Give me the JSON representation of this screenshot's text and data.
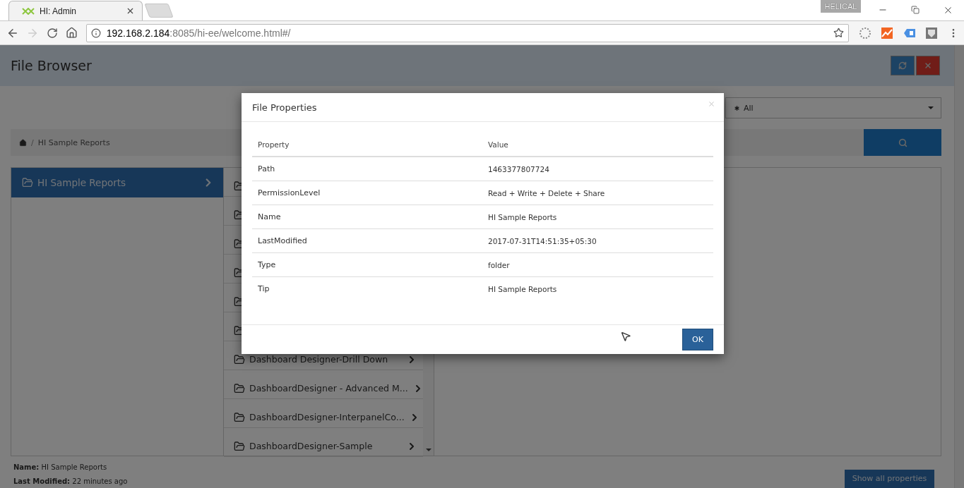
{
  "browser": {
    "tab": {
      "title": "HI: Admin"
    },
    "profile": "HELICAL",
    "nav": {
      "forward_disabled": true
    },
    "address": {
      "host": "192.168.2.184",
      "rest": ":8085/hi-ee/welcome.html#/"
    }
  },
  "page": {
    "title": "File Browser",
    "filter": {
      "value": "All"
    },
    "breadcrumb": {
      "separator": "/",
      "items": [
        "HI Sample Reports"
      ]
    },
    "root_folder": {
      "name": "HI Sample Reports",
      "selected": true
    },
    "folders": [
      {
        "kind": "covered"
      },
      {
        "kind": "covered"
      },
      {
        "kind": "covered"
      },
      {
        "kind": "covered"
      },
      {
        "kind": "covered"
      },
      {
        "kind": "covered"
      },
      {
        "kind": "named",
        "name": "Dashboard Designer-Drill Down"
      },
      {
        "kind": "named",
        "name": "DashboardDesigner - Advanced M..."
      },
      {
        "kind": "named",
        "name": "DashboardDesigner-InterpanelCo..."
      },
      {
        "kind": "named",
        "name": "DashboardDesigner-Sample"
      }
    ],
    "details": [
      {
        "label": "Name:",
        "value": "HI Sample Reports"
      },
      {
        "label": "Last Modified:",
        "value": "22 minutes ago"
      }
    ],
    "show_all_button": "Show all properties"
  },
  "dialog": {
    "title": "File Properties",
    "columns": [
      "Property",
      "Value"
    ],
    "rows": [
      {
        "property": "Path",
        "value": "1463377807724"
      },
      {
        "property": "PermissionLevel",
        "value": "Read + Write + Delete + Share"
      },
      {
        "property": "Name",
        "value": "HI Sample Reports"
      },
      {
        "property": "LastModified",
        "value": "2017-07-31T14:51:35+05:30"
      },
      {
        "property": "Type",
        "value": "folder"
      },
      {
        "property": "Tip",
        "value": "HI Sample Reports"
      }
    ],
    "ok_button": "OK"
  }
}
